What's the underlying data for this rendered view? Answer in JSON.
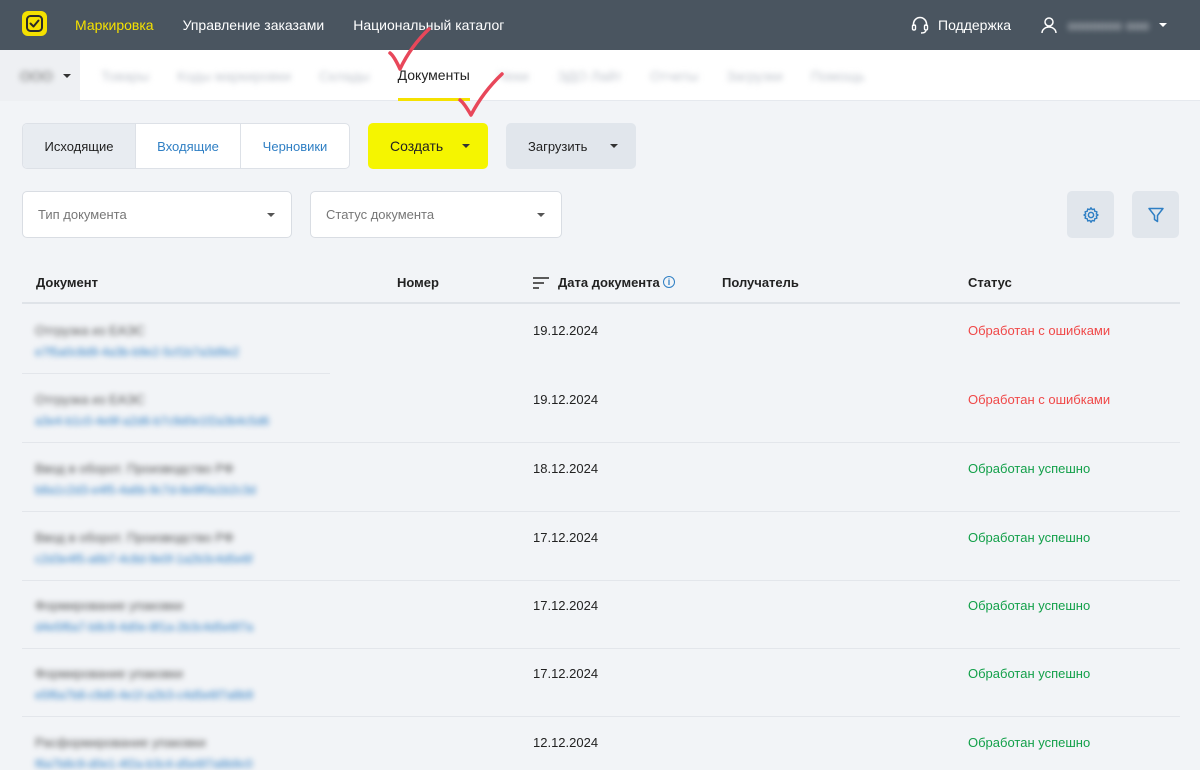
{
  "topbar": {
    "nav": [
      "Маркировка",
      "Управление заказами",
      "Национальный каталог"
    ],
    "support_label": "Поддержка",
    "user_name": "ооооооо ооо"
  },
  "subnav": {
    "org_name": "ООО",
    "tabs": [
      "Товары",
      "Коды маркировки",
      "Склады",
      "Документы",
      "Чеки",
      "ЭДО Лайт",
      "Отчеты",
      "Загрузки",
      "Помощь"
    ],
    "active_tab": "Документы"
  },
  "toolbar": {
    "segments": [
      "Исходящие",
      "Входящие",
      "Черновики"
    ],
    "active_segment": "Исходящие",
    "create_label": "Создать",
    "upload_label": "Загрузить"
  },
  "filters": {
    "doc_type_placeholder": "Тип документа",
    "doc_status_placeholder": "Статус документа"
  },
  "table": {
    "columns": {
      "document": "Документ",
      "number": "Номер",
      "date": "Дата документа",
      "recipient": "Получатель",
      "status": "Статус"
    },
    "rows": [
      {
        "title": "Отгрузка из ЕАЭС",
        "id": "e7f5a0c8d9-4a3b-b9e2-5cf1b7a3d9e2",
        "date": "19.12.2024",
        "status": "Обработан с ошибками",
        "status_type": "error"
      },
      {
        "title": "Отгрузка из ЕАЭС",
        "id": "a3e4-b1c0-4e9f-a2d6-b7c9d0e1f2a3b4c5d6",
        "date": "19.12.2024",
        "status": "Обработан с ошибками",
        "status_type": "error"
      },
      {
        "title": "Ввод в оборот. Производство РФ",
        "id": "b8a1c2d3-e4f5-4a6b-9c7d-8e9f0a1b2c3d",
        "date": "18.12.2024",
        "status": "Обработан успешно",
        "status_type": "ok"
      },
      {
        "title": "Ввод в оборот. Производство РФ",
        "id": "c2d3e4f5-a6b7-4c8d-9e0f-1a2b3c4d5e6f",
        "date": "17.12.2024",
        "status": "Обработан успешно",
        "status_type": "ok"
      },
      {
        "title": "Формирование упаковки",
        "id": "d4e5f6a7-b8c9-4d0e-8f1a-2b3c4d5e6f7a",
        "date": "17.12.2024",
        "status": "Обработан успешно",
        "status_type": "ok"
      },
      {
        "title": "Формирование упаковки",
        "id": "e5f6a7b8-c9d0-4e1f-a2b3-c4d5e6f7a8b9",
        "date": "17.12.2024",
        "status": "Обработан успешно",
        "status_type": "ok"
      },
      {
        "title": "Расформирование упаковки",
        "id": "f6a7b8c9-d0e1-4f2a-b3c4-d5e6f7a8b9c0",
        "date": "12.12.2024",
        "status": "Обработан успешно",
        "status_type": "ok"
      }
    ]
  },
  "colors": {
    "accent_yellow": "#f5f500",
    "topbar_bg": "#4a5560",
    "link_blue": "#2f7fc4",
    "error_red": "#f04848",
    "success_green": "#13a04a",
    "annotation_red": "#e8475a"
  },
  "icons": [
    "logo-icon",
    "headset-icon",
    "user-icon",
    "settings-gear-icon",
    "filter-funnel-icon",
    "sort-icon",
    "info-icon",
    "annotation-checkmark-icon"
  ]
}
